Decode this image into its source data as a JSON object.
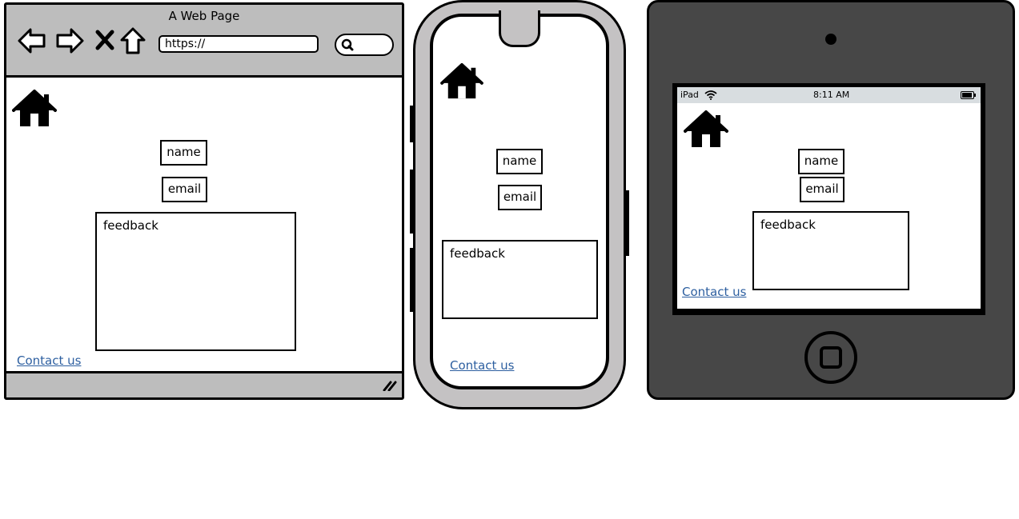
{
  "browser": {
    "title": "A Web Page",
    "url": "https://",
    "name_field": "name",
    "email_field": "email",
    "feedback_field": "feedback",
    "contact_link": "Contact us"
  },
  "phone": {
    "name_field": "name",
    "email_field": "email",
    "feedback_field": "feedback",
    "contact_link": "Contact us"
  },
  "tablet": {
    "status": {
      "device": "iPad",
      "time": "8:11 AM"
    },
    "name_field": "name",
    "email_field": "email",
    "feedback_field": "feedback",
    "contact_link": "Contact us"
  },
  "icons": [
    "back-arrow-icon",
    "forward-arrow-icon",
    "stop-icon",
    "home-nav-icon",
    "search-icon",
    "house-icon",
    "resize-grip-icon",
    "wifi-icon",
    "battery-icon"
  ]
}
